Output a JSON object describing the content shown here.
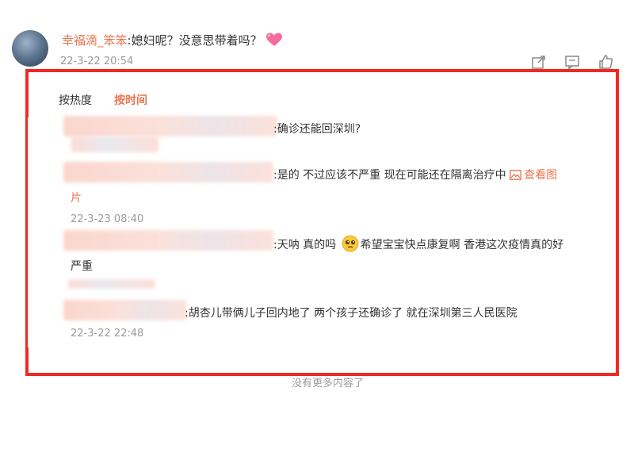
{
  "top_comment": {
    "username": "幸福滴_笨笨",
    "text": ":媳妇呢？没意思带着吗？",
    "time": "22-3-22 20:54"
  },
  "sort_tabs": {
    "hot": "按热度",
    "time": "按时间"
  },
  "replies": [
    {
      "text": ":确诊还能回深圳?"
    },
    {
      "text": ":是的  不过应该不严重 现在可能还在隔离治疗中 ",
      "link": "查看图",
      "link_cont": "片",
      "time": "22-3-23 08:40"
    },
    {
      "text": ":天呐 真的吗 ",
      "text2": "希望宝宝快点康复啊 香港这次疫情真的好",
      "text3": "严重"
    },
    {
      "text": ":胡杏儿带俩儿子回内地了 两个孩子还确诊了 就在深圳第三人民医院",
      "time": "22-3-22 22:48"
    }
  ],
  "footer": {
    "more": "没有更多内容了"
  },
  "colors": {
    "accent": "#eb7350",
    "frame": "#ee2a24",
    "muted": "#9a9a9a"
  }
}
